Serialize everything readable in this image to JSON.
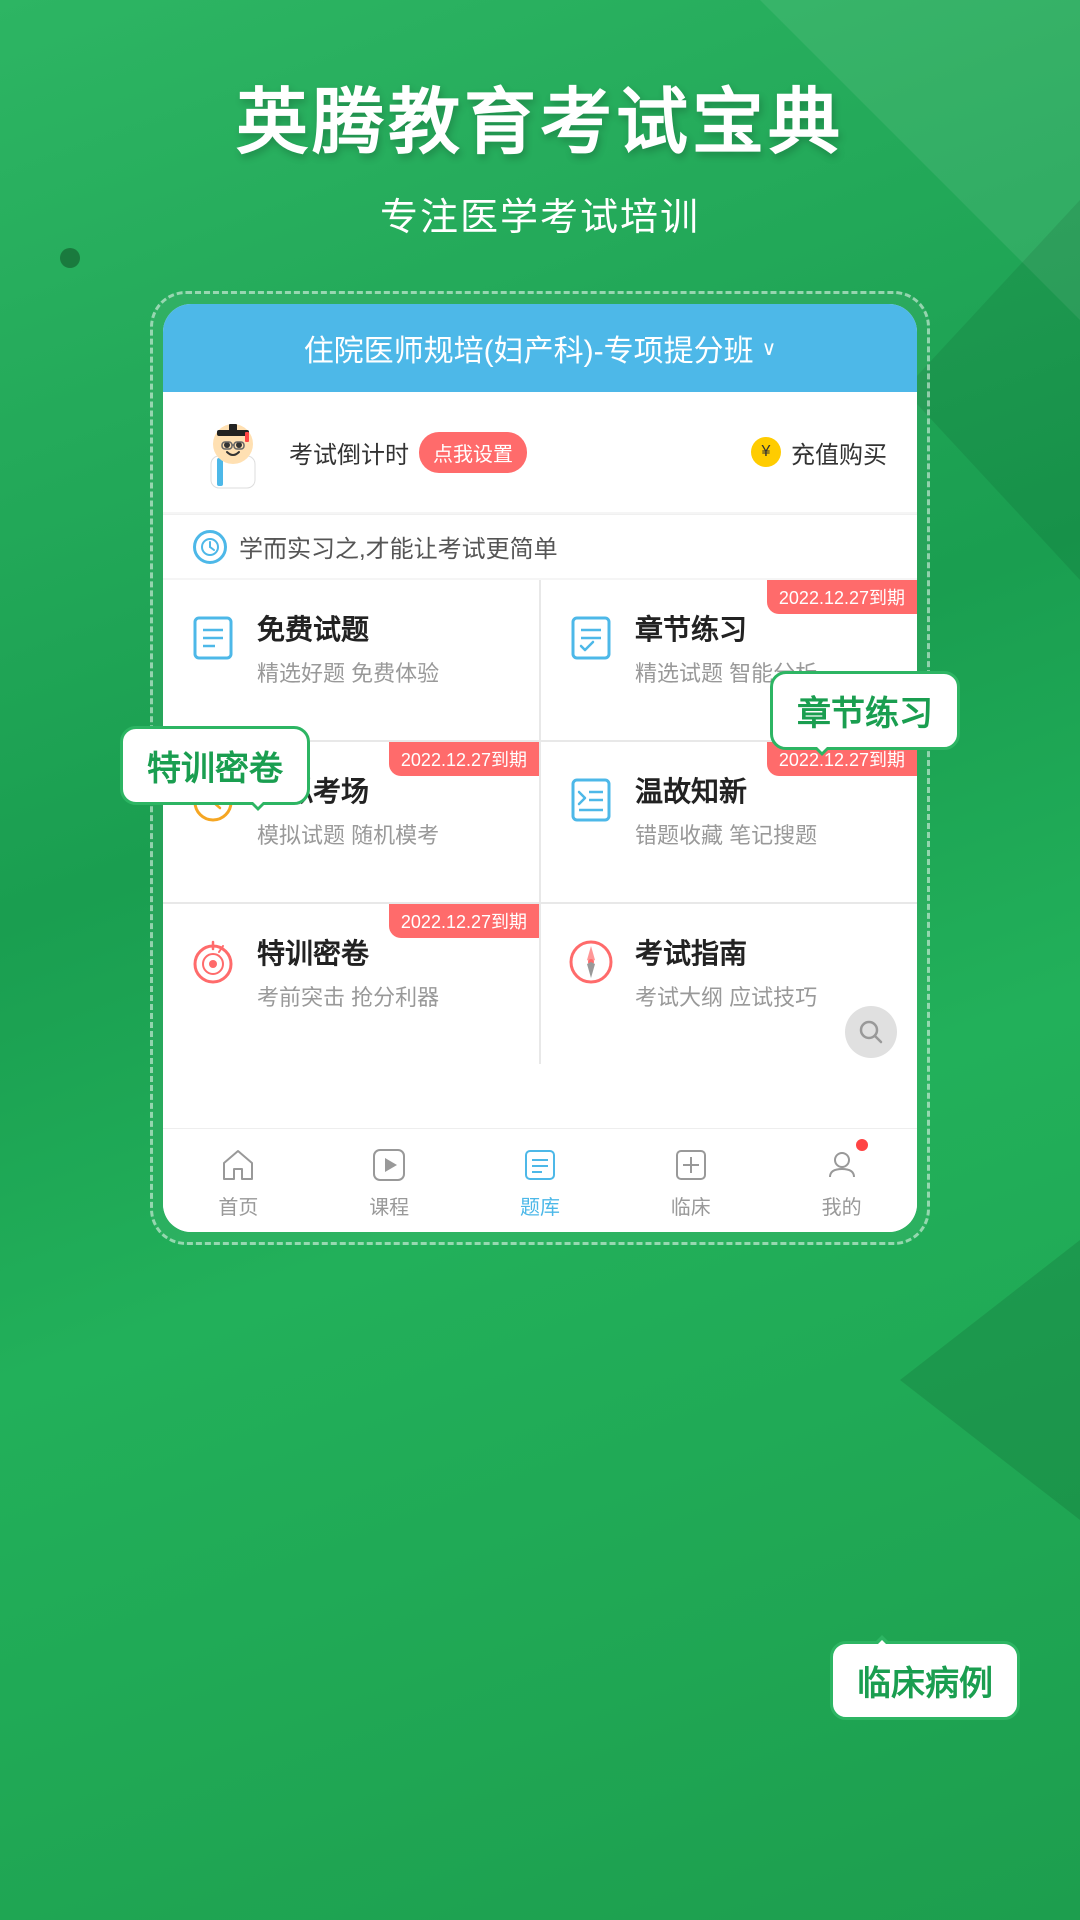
{
  "app": {
    "name": "英腾教育考试宝典",
    "tagline": "专注医学考试培训"
  },
  "header": {
    "course_selector": "住院医师规培(妇产科)-专项提分班",
    "countdown_label": "考试倒计时",
    "countdown_btn": "点我设置",
    "recharge_label": "充值购买"
  },
  "slogan": "学而实习之,才能让考试更简单",
  "callouts": {
    "chapter": "章节练习",
    "miju": "特训密卷",
    "linbed": "临床病例"
  },
  "grid_items": [
    {
      "id": "free-questions",
      "title": "免费试题",
      "desc": "精选好题 免费体验",
      "icon": "document-icon",
      "has_badge": false,
      "badge_text": ""
    },
    {
      "id": "chapter-practice",
      "title": "章节练习",
      "desc": "精选试题 智能分析",
      "icon": "chapter-icon",
      "has_badge": true,
      "badge_text": "2022.12.27到期"
    },
    {
      "id": "mock-exam",
      "title": "模拟考场",
      "desc": "模拟试题 随机模考",
      "icon": "clock-icon",
      "has_badge": true,
      "badge_text": "2022.12.27到期"
    },
    {
      "id": "review",
      "title": "温故知新",
      "desc": "错题收藏 笔记搜题",
      "icon": "review-icon",
      "has_badge": true,
      "badge_text": "2022.12.27到期"
    },
    {
      "id": "special-paper",
      "title": "特训密卷",
      "desc": "考前突击 抢分利器",
      "icon": "target-icon",
      "has_badge": true,
      "badge_text": "2022.12.27到期"
    },
    {
      "id": "exam-guide",
      "title": "考试指南",
      "desc": "考试大纲 应试技巧",
      "icon": "compass-icon",
      "has_badge": false,
      "badge_text": ""
    }
  ],
  "bottom_nav": [
    {
      "id": "home",
      "label": "首页",
      "icon": "home-icon",
      "active": false,
      "has_dot": false
    },
    {
      "id": "course",
      "label": "课程",
      "icon": "play-icon",
      "active": false,
      "has_dot": false
    },
    {
      "id": "questions",
      "label": "题库",
      "icon": "questions-icon",
      "active": true,
      "has_dot": false
    },
    {
      "id": "clinical",
      "label": "临床",
      "icon": "clinical-icon",
      "active": false,
      "has_dot": false
    },
    {
      "id": "mine",
      "label": "我的",
      "icon": "person-icon",
      "active": false,
      "has_dot": true
    }
  ],
  "colors": {
    "green": "#2db563",
    "blue": "#4db8e8",
    "red": "#ff6b6b",
    "accent": "#1a9e50"
  }
}
